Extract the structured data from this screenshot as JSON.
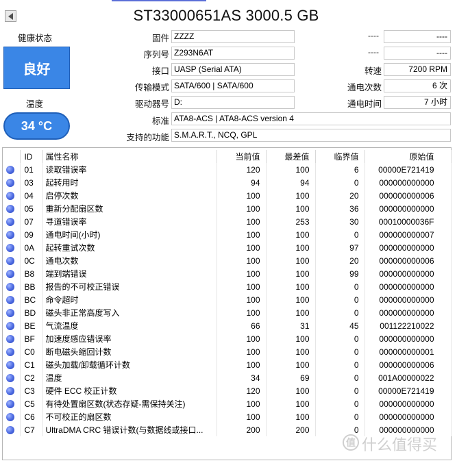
{
  "title": "ST33000651AS 3000.5 GB",
  "health": {
    "label": "健康状态",
    "value": "良好"
  },
  "temperature": {
    "label": "温度",
    "value": "34 °C"
  },
  "fields": {
    "firmware": {
      "label": "固件",
      "value": "ZZZZ"
    },
    "serial": {
      "label": "序列号",
      "value": "Z293N6AT"
    },
    "interface": {
      "label": "接口",
      "value": "UASP (Serial ATA)"
    },
    "transfer": {
      "label": "传输模式",
      "value": "SATA/600 | SATA/600"
    },
    "drive_letter": {
      "label": "驱动器号",
      "value": "D:"
    },
    "standard": {
      "label": "标准",
      "value": "ATA8-ACS | ATA8-ACS version 4"
    },
    "features": {
      "label": "支持的功能",
      "value": "S.M.A.R.T., NCQ, GPL"
    }
  },
  "right": {
    "blank1_left": "----",
    "blank1_right": "----",
    "blank2_left": "----",
    "blank2_right": "----",
    "rotation": {
      "label": "转速",
      "value": "7200 RPM"
    },
    "power_count": {
      "label": "通电次数",
      "value": "6 次"
    },
    "power_hours": {
      "label": "通电时间",
      "value": "7 小时"
    }
  },
  "table": {
    "headers": {
      "id": "ID",
      "name": "属性名称",
      "current": "当前值",
      "worst": "最差值",
      "threshold": "临界值",
      "raw": "原始值"
    },
    "rows": [
      {
        "id": "01",
        "name": "读取错误率",
        "current": "120",
        "worst": "100",
        "threshold": "6",
        "raw": "00000E721419"
      },
      {
        "id": "03",
        "name": "起转用时",
        "current": "94",
        "worst": "94",
        "threshold": "0",
        "raw": "000000000000"
      },
      {
        "id": "04",
        "name": "启停次数",
        "current": "100",
        "worst": "100",
        "threshold": "20",
        "raw": "000000000006"
      },
      {
        "id": "05",
        "name": "重新分配扇区数",
        "current": "100",
        "worst": "100",
        "threshold": "36",
        "raw": "000000000000"
      },
      {
        "id": "07",
        "name": "寻道错误率",
        "current": "100",
        "worst": "253",
        "threshold": "30",
        "raw": "00010000036F"
      },
      {
        "id": "09",
        "name": "通电时间(小时)",
        "current": "100",
        "worst": "100",
        "threshold": "0",
        "raw": "000000000007"
      },
      {
        "id": "0A",
        "name": "起转重试次数",
        "current": "100",
        "worst": "100",
        "threshold": "97",
        "raw": "000000000000"
      },
      {
        "id": "0C",
        "name": "通电次数",
        "current": "100",
        "worst": "100",
        "threshold": "20",
        "raw": "000000000006"
      },
      {
        "id": "B8",
        "name": "端到端错误",
        "current": "100",
        "worst": "100",
        "threshold": "99",
        "raw": "000000000000"
      },
      {
        "id": "BB",
        "name": "报告的不可校正错误",
        "current": "100",
        "worst": "100",
        "threshold": "0",
        "raw": "000000000000"
      },
      {
        "id": "BC",
        "name": "命令超时",
        "current": "100",
        "worst": "100",
        "threshold": "0",
        "raw": "000000000000"
      },
      {
        "id": "BD",
        "name": "磁头非正常高度写入",
        "current": "100",
        "worst": "100",
        "threshold": "0",
        "raw": "000000000000"
      },
      {
        "id": "BE",
        "name": "气流温度",
        "current": "66",
        "worst": "31",
        "threshold": "45",
        "raw": "001122210022"
      },
      {
        "id": "BF",
        "name": "加速度感应错误率",
        "current": "100",
        "worst": "100",
        "threshold": "0",
        "raw": "000000000000"
      },
      {
        "id": "C0",
        "name": "断电磁头缩回计数",
        "current": "100",
        "worst": "100",
        "threshold": "0",
        "raw": "000000000001"
      },
      {
        "id": "C1",
        "name": "磁头加载/卸载循环计数",
        "current": "100",
        "worst": "100",
        "threshold": "0",
        "raw": "000000000006"
      },
      {
        "id": "C2",
        "name": "温度",
        "current": "34",
        "worst": "69",
        "threshold": "0",
        "raw": "001A00000022"
      },
      {
        "id": "C3",
        "name": "硬件 ECC 校正计数",
        "current": "120",
        "worst": "100",
        "threshold": "0",
        "raw": "00000E721419"
      },
      {
        "id": "C5",
        "name": "有待处置扇区数(状态存疑-需保持关注)",
        "current": "100",
        "worst": "100",
        "threshold": "0",
        "raw": "000000000000"
      },
      {
        "id": "C6",
        "name": "不可校正的扇区数",
        "current": "100",
        "worst": "100",
        "threshold": "0",
        "raw": "000000000000"
      },
      {
        "id": "C7",
        "name": "UltraDMA CRC 错误计数(与数据线或接口...",
        "current": "200",
        "worst": "200",
        "threshold": "0",
        "raw": "000000000000"
      }
    ]
  },
  "watermark": {
    "text": "什么值得买",
    "icon": "值"
  },
  "colors": {
    "accent": "#3a86e6",
    "status_dot": "#4a68e0"
  }
}
